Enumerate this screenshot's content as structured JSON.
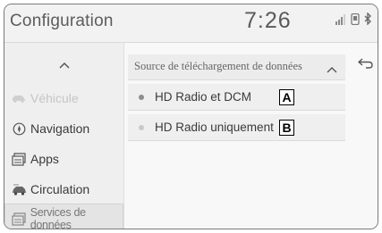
{
  "status_bar": {
    "title": "Configuration",
    "time": "7:26",
    "icons": [
      "signal-bars-icon",
      "phone-icon",
      "bluetooth-icon"
    ]
  },
  "sidebar": {
    "scroll_up_icon": "chevron-up-icon",
    "items": [
      {
        "label": "Véhicule",
        "icon": "car-icon",
        "state": "disabled"
      },
      {
        "label": "Navigation",
        "icon": "compass-icon",
        "state": "normal"
      },
      {
        "label": "Apps",
        "icon": "apps-icon",
        "state": "normal"
      },
      {
        "label": "Circulation",
        "icon": "traffic-car-icon",
        "state": "normal"
      },
      {
        "label": "Services de données",
        "icon": "data-services-icon",
        "state": "selected"
      }
    ]
  },
  "panel": {
    "header": "Source de téléchargement de données",
    "header_icon": "chevron-up-icon",
    "back_icon": "back-arrow-icon",
    "options": [
      {
        "label": "HD Radio et DCM",
        "badge": "A",
        "indicator": "active"
      },
      {
        "label": "HD Radio uniquement",
        "badge": "B",
        "indicator": "inactive"
      }
    ]
  }
}
